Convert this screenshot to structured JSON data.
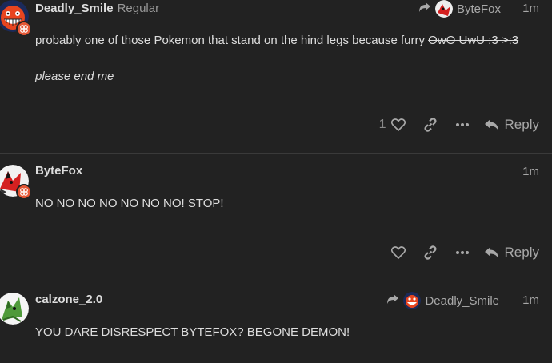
{
  "posts": [
    {
      "username": "Deadly_Smile",
      "user_title": "Regular",
      "reply_to": "ByteFox",
      "time": "1m",
      "body_main": "probably one of those Pokemon that stand on the hind legs because furry ",
      "body_strike": "OwO UwU :3 >:3",
      "body_italic": "please end me",
      "like_count": "1",
      "reply_label": "Reply"
    },
    {
      "username": "ByteFox",
      "time": "1m",
      "body_main": "NO NO NO NO NO NO NO! STOP!",
      "reply_label": "Reply"
    },
    {
      "username": "calzone_2.0",
      "reply_to": "Deadly_Smile",
      "time": "1m",
      "body_main": "YOU DARE DISRESPECT BYTEFOX? BEGONE DEMON!"
    }
  ],
  "colors": {
    "background": "#222222",
    "text": "#dddddd",
    "muted": "#a8a8a8",
    "flair": "#e45735"
  },
  "icons": [
    "share-arrow-icon",
    "heart-icon",
    "link-icon",
    "more-icon",
    "reply-icon",
    "flair-icon"
  ]
}
